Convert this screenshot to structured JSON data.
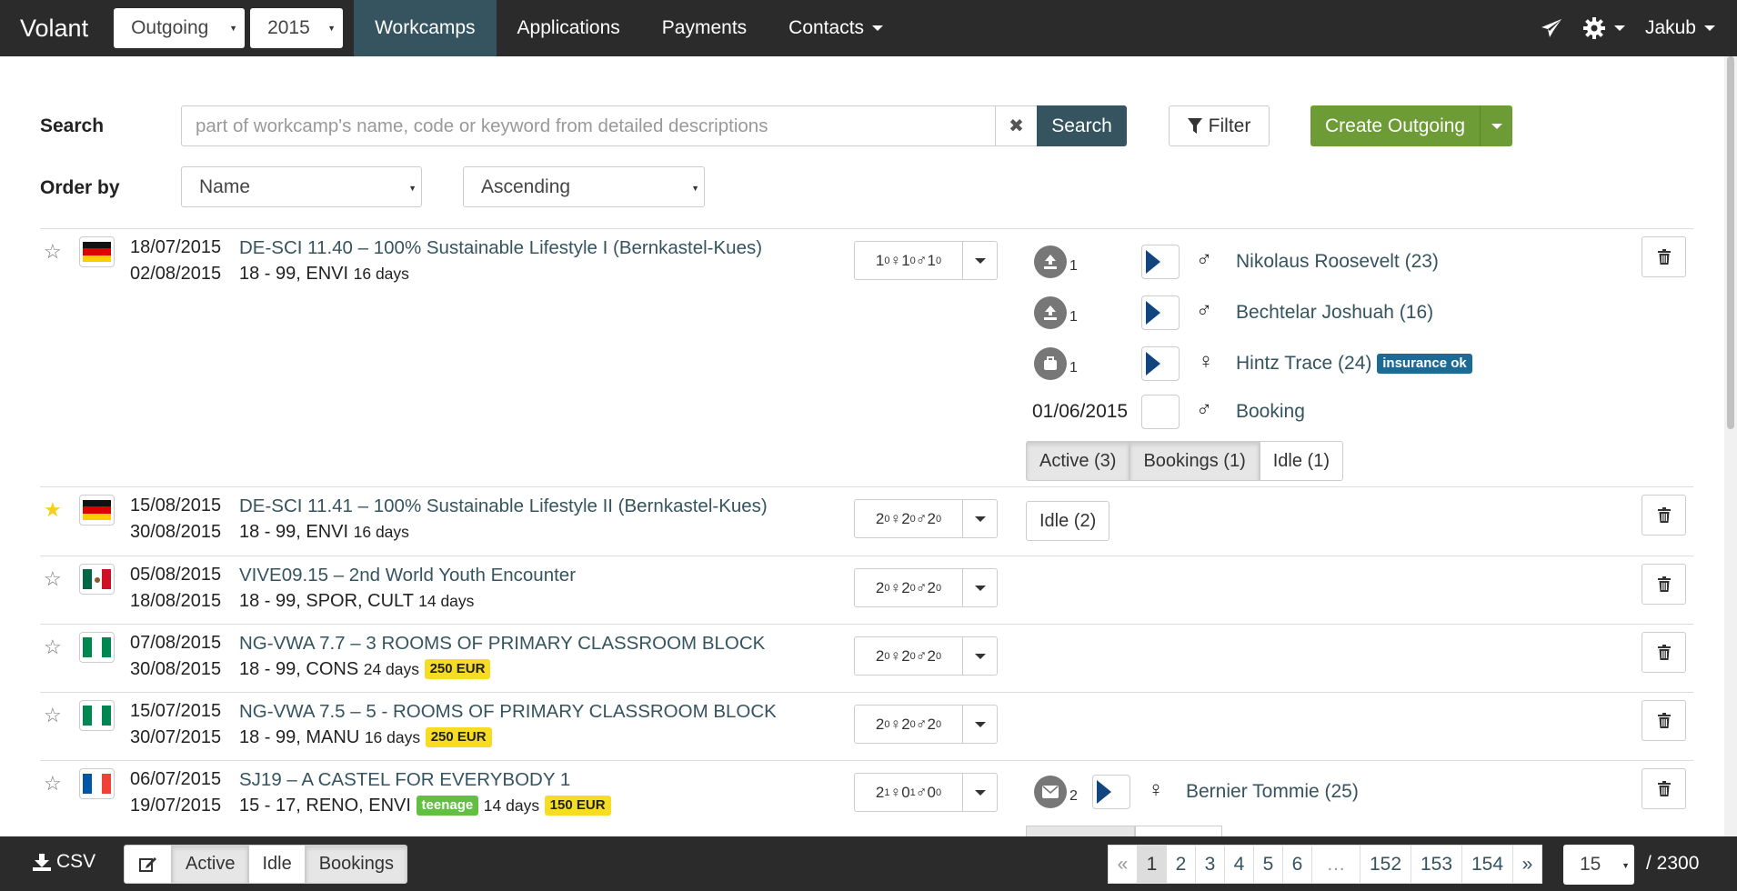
{
  "app": {
    "brand": "Volant"
  },
  "nav": {
    "mode": "Outgoing",
    "year": "2015",
    "links": [
      "Workcamps",
      "Applications",
      "Payments",
      "Contacts"
    ],
    "user": "Jakub"
  },
  "search": {
    "label": "Search",
    "placeholder": "part of workcamp's name, code or keyword from detailed descriptions",
    "button": "Search",
    "filter": "Filter",
    "create": "Create Outgoing",
    "order_label": "Order by",
    "order_field": "Name",
    "order_dir": "Ascending"
  },
  "rows": [
    {
      "starred": false,
      "flag": "de",
      "from": "18/07/2015",
      "to": "02/08/2015",
      "title": "DE-SCI 11.40 – 100% Sustainable Lifestyle I (Bernkastel-Kues)",
      "sub": "18 - 99, ENVI",
      "duration": "16 days",
      "cap": {
        "t": "1",
        "ti": "0",
        "f": "1",
        "fi": "0",
        "m": "1",
        "mi": "0"
      },
      "applications": [
        {
          "icon": "upload-icon",
          "count": "1",
          "flag": "cz",
          "sex": "♂",
          "name": "Nikolaus Roosevelt (23)"
        },
        {
          "icon": "upload-icon",
          "count": "1",
          "flag": "cz",
          "sex": "♂",
          "name": "Bechtelar Joshuah (16)"
        },
        {
          "icon": "suitcase-icon",
          "count": "1",
          "flag": "cz",
          "sex": "♀",
          "name": "Hintz Trace (24)",
          "badge": "insurance ok"
        },
        {
          "date": "01/06/2015",
          "flag": "be",
          "sex": "♂",
          "name": "Booking"
        }
      ],
      "groups": [
        "Active (3)",
        "Bookings (1)",
        "Idle (1)"
      ]
    },
    {
      "starred": true,
      "flag": "de",
      "from": "15/08/2015",
      "to": "30/08/2015",
      "title": "DE-SCI 11.41 – 100% Sustainable Lifestyle II (Bernkastel-Kues)",
      "sub": "18 - 99, ENVI",
      "duration": "16 days",
      "cap": {
        "t": "2",
        "ti": "0",
        "f": "2",
        "fi": "0",
        "m": "2",
        "mi": "0"
      },
      "groups": [
        "Idle (2)"
      ]
    },
    {
      "starred": false,
      "flag": "mx",
      "from": "05/08/2015",
      "to": "18/08/2015",
      "title": "VIVE09.15 – 2nd World Youth Encounter",
      "sub": "18 - 99, SPOR, CULT",
      "duration": "14 days",
      "cap": {
        "t": "2",
        "ti": "0",
        "f": "2",
        "fi": "0",
        "m": "2",
        "mi": "0"
      }
    },
    {
      "starred": false,
      "flag": "ng",
      "from": "07/08/2015",
      "to": "30/08/2015",
      "title": "NG-VWA 7.7 – 3 ROOMS OF PRIMARY CLASSROOM BLOCK",
      "sub": "18 - 99, CONS",
      "duration": "24 days",
      "fee": "250 EUR",
      "cap": {
        "t": "2",
        "ti": "0",
        "f": "2",
        "fi": "0",
        "m": "2",
        "mi": "0"
      }
    },
    {
      "starred": false,
      "flag": "ng",
      "from": "15/07/2015",
      "to": "30/07/2015",
      "title": "NG-VWA 7.5 – 5 - ROOMS OF PRIMARY CLASSROOM BLOCK",
      "sub": "18 - 99, MANU",
      "duration": "16 days",
      "fee": "250 EUR",
      "cap": {
        "t": "2",
        "ti": "0",
        "f": "2",
        "fi": "0",
        "m": "2",
        "mi": "0"
      }
    },
    {
      "starred": false,
      "flag": "fr",
      "from": "06/07/2015",
      "to": "19/07/2015",
      "title": "SJ19 – A CASTEL FOR EVERYBODY 1",
      "sub": "15 - 17, RENO, ENVI",
      "teen": "teenage",
      "duration": "14 days",
      "fee": "150 EUR",
      "cap": {
        "t": "2",
        "ti": "1",
        "f": "0",
        "fi": "1",
        "m": "0",
        "mi": "0"
      },
      "applications": [
        {
          "icon": "envelope-icon",
          "count": "2",
          "flag": "cz",
          "sex": "♀",
          "name": "Bernier Tommie (25)"
        }
      ]
    }
  ],
  "footer": {
    "csv": "CSV",
    "groups": [
      "Active",
      "Idle",
      "Bookings"
    ],
    "pages": [
      "«",
      "1",
      "2",
      "3",
      "4",
      "5",
      "6",
      "…",
      "152",
      "153",
      "154",
      "»"
    ],
    "current_page": "1",
    "per_page": "15",
    "total": "/ 2300"
  },
  "colors": {
    "navbar": "#2b2b2b",
    "accent": "#35545f",
    "create": "#6d9b35",
    "eur_badge": "#f7dc24",
    "teen_badge": "#61c03f",
    "insurance_badge": "#1d6a94"
  }
}
